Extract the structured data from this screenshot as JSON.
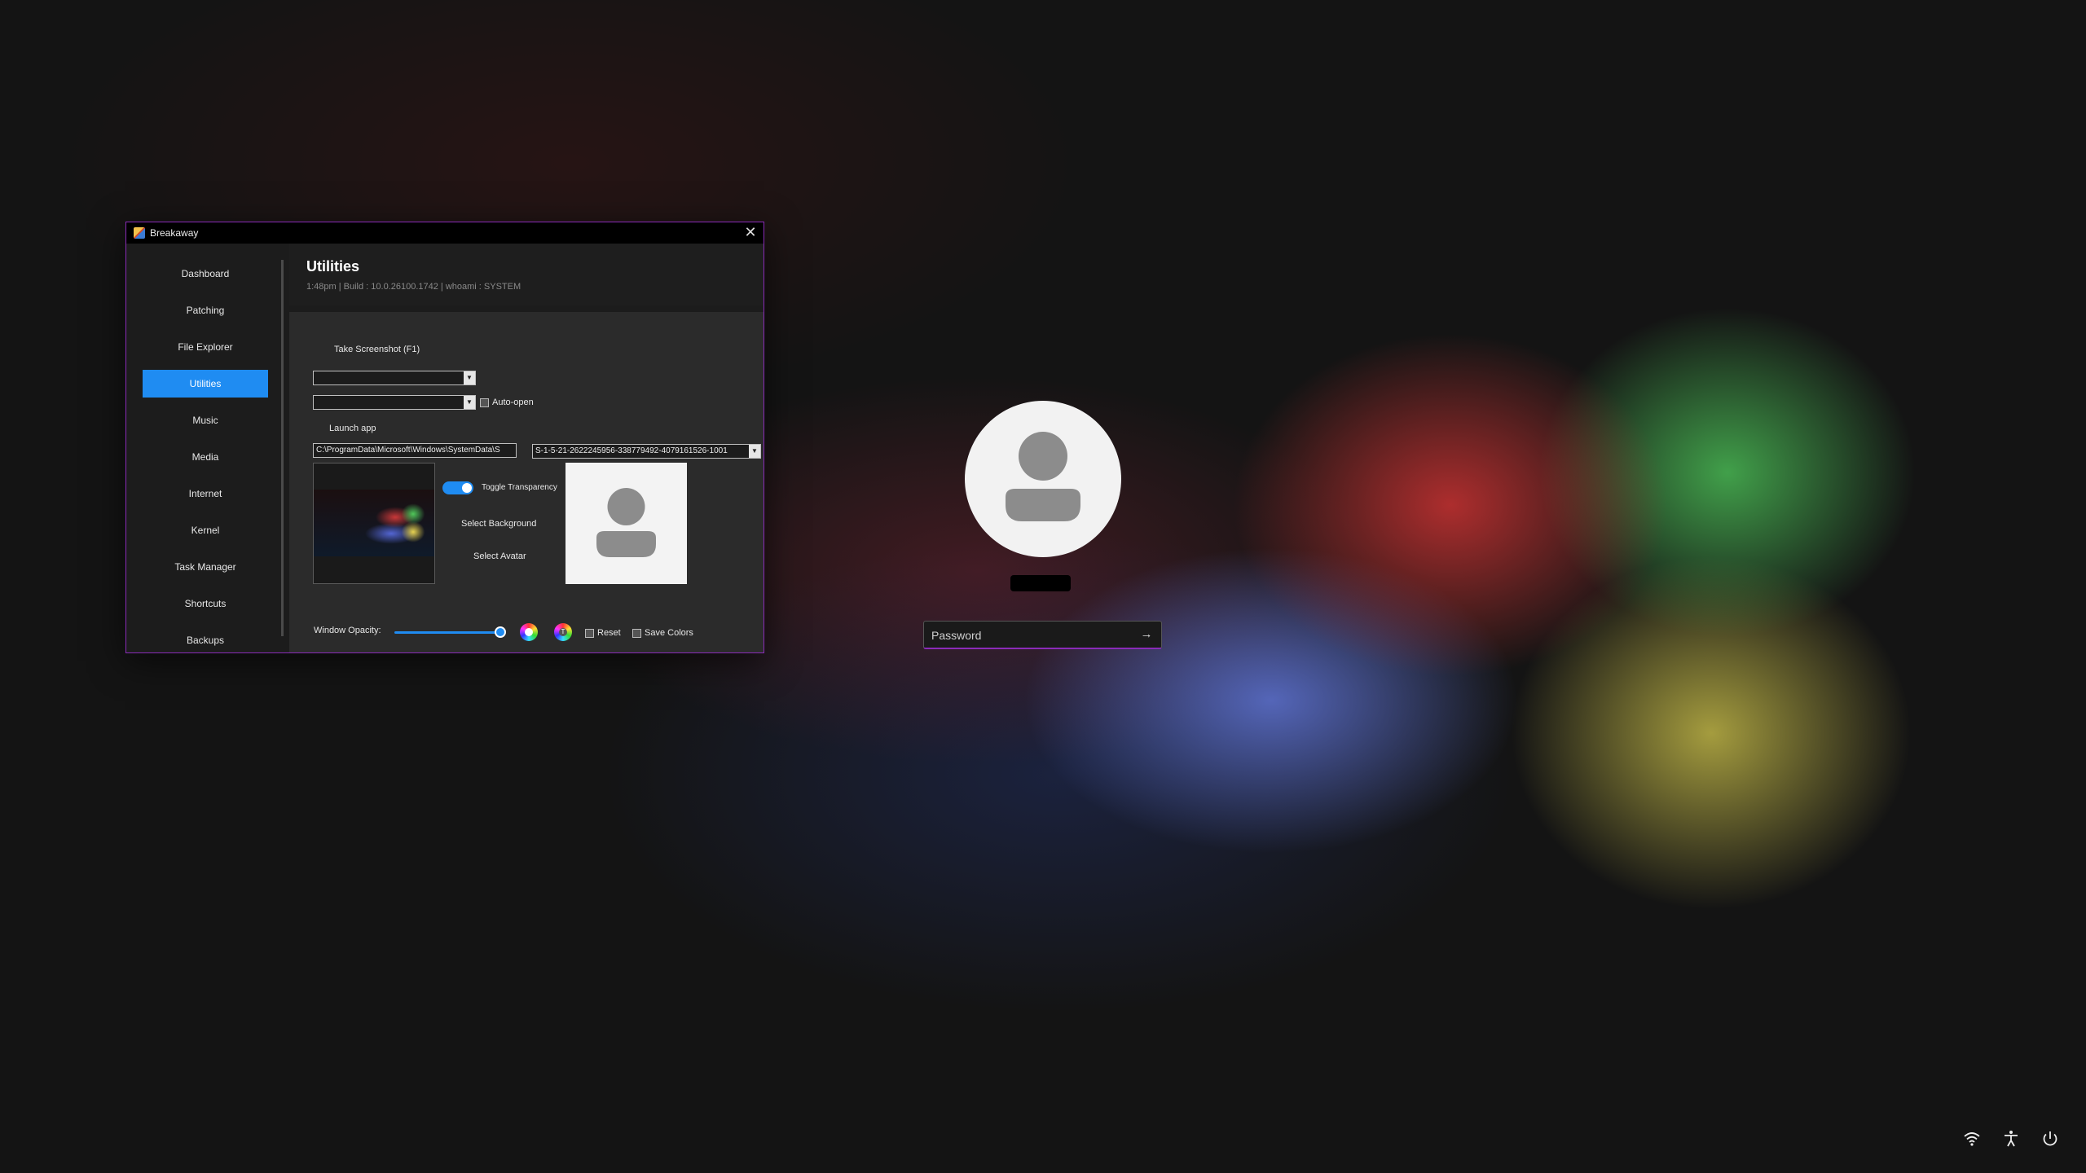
{
  "window": {
    "title": "Breakaway",
    "close_label": "✕"
  },
  "sidebar": {
    "items": [
      {
        "label": "Dashboard"
      },
      {
        "label": "Patching"
      },
      {
        "label": "File Explorer"
      },
      {
        "label": "Utilities",
        "active": true
      },
      {
        "label": "Music"
      },
      {
        "label": "Media"
      },
      {
        "label": "Internet"
      },
      {
        "label": "Kernel"
      },
      {
        "label": "Task Manager"
      },
      {
        "label": "Shortcuts"
      },
      {
        "label": "Backups"
      }
    ]
  },
  "header": {
    "title": "Utilities",
    "subtitle": "1:48pm | Build : 10.0.26100.1742 | whoami : SYSTEM"
  },
  "utilities": {
    "screenshot_label": "Take Screenshot (F1)",
    "combo1_value": "",
    "combo2_value": "",
    "auto_open_label": "Auto-open",
    "launch_label": "Launch app",
    "path_value": "C:\\ProgramData\\Microsoft\\Windows\\SystemData\\S",
    "sid_value": "S-1-5-21-2622245956-338779492-4079161526-1001",
    "toggle_label": "Toggle Transparency",
    "select_background_label": "Select Background",
    "select_avatar_label": "Select Avatar",
    "opacity_label": "Window Opacity:",
    "opacity_value": 0.95,
    "reset_label": "Reset",
    "save_colors_label": "Save Colors",
    "text_color_glyph": "T"
  },
  "lockscreen": {
    "password_placeholder": "Password",
    "submit_glyph": "→"
  },
  "colors": {
    "accent": "#1f8cf2",
    "window_border": "#8a2bb8"
  },
  "tray": {
    "icons": [
      "wifi-icon",
      "accessibility-icon",
      "power-icon"
    ]
  }
}
